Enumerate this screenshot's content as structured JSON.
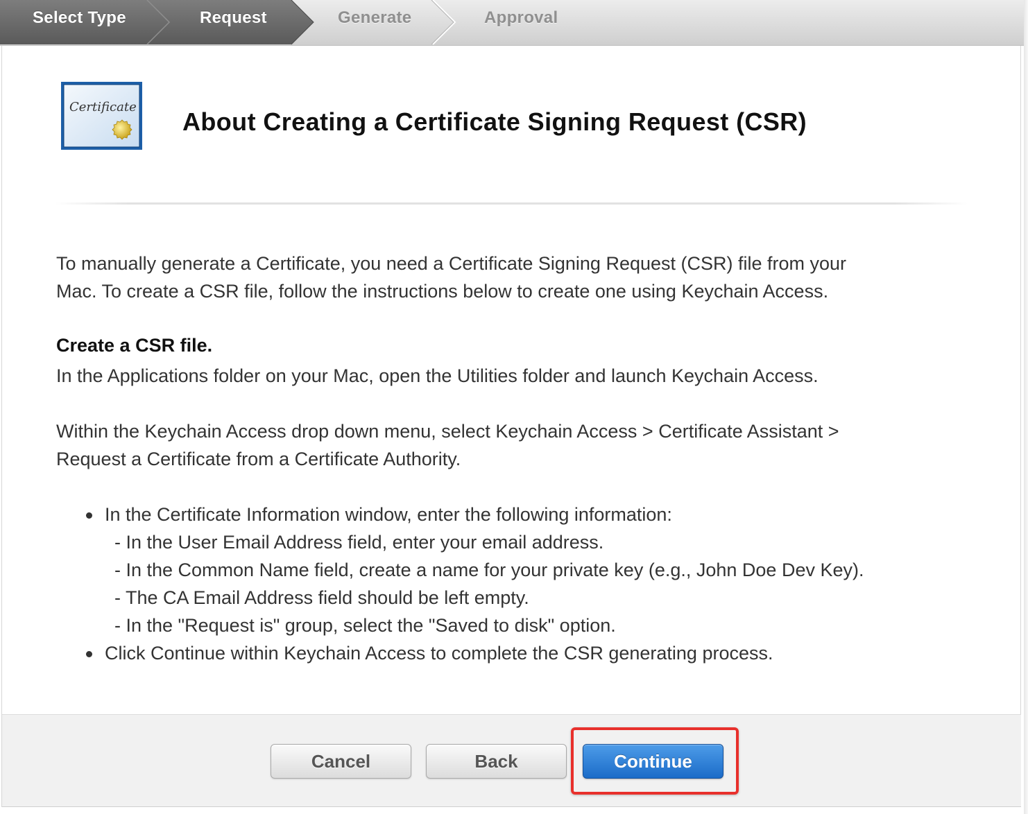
{
  "steps": [
    {
      "label": "Select Type",
      "state": "done"
    },
    {
      "label": "Request",
      "state": "done"
    },
    {
      "label": "Generate",
      "state": "todo"
    },
    {
      "label": "Approval",
      "state": "todo"
    }
  ],
  "icon": {
    "name": "certificate-icon",
    "script_text": "Certificate"
  },
  "heading": "About Creating a Certificate Signing Request (CSR)",
  "intro": {
    "line1": "To manually generate a Certificate, you need a Certificate Signing Request (CSR) file from your",
    "line2": "Mac. To create a CSR file, follow the instructions below to create one using Keychain Access."
  },
  "section_title": "Create a CSR file.",
  "instructions": {
    "p1": "In the Applications folder on your Mac, open the Utilities folder and launch Keychain Access.",
    "p2_line1": "Within the Keychain Access drop down menu, select Keychain Access > Certificate Assistant >",
    "p2_line2": "Request a Certificate from a Certificate Authority."
  },
  "bullets": {
    "b1": "In the Certificate Information window, enter the following information:",
    "sub": [
      "- In the User Email Address field, enter your email address.",
      "- In the Common Name field, create a name for your private key (e.g., John Doe Dev Key).",
      "- The CA Email Address field should be left empty.",
      "- In the \"Request is\" group, select the \"Saved to disk\" option."
    ],
    "b2": "Click Continue within Keychain Access to complete the CSR generating process."
  },
  "buttons": {
    "cancel": "Cancel",
    "back": "Back",
    "continue": "Continue"
  },
  "colors": {
    "primary_button": "#1b6cc8",
    "highlight": "#e8302c",
    "step_done": "#6b6b6b"
  }
}
